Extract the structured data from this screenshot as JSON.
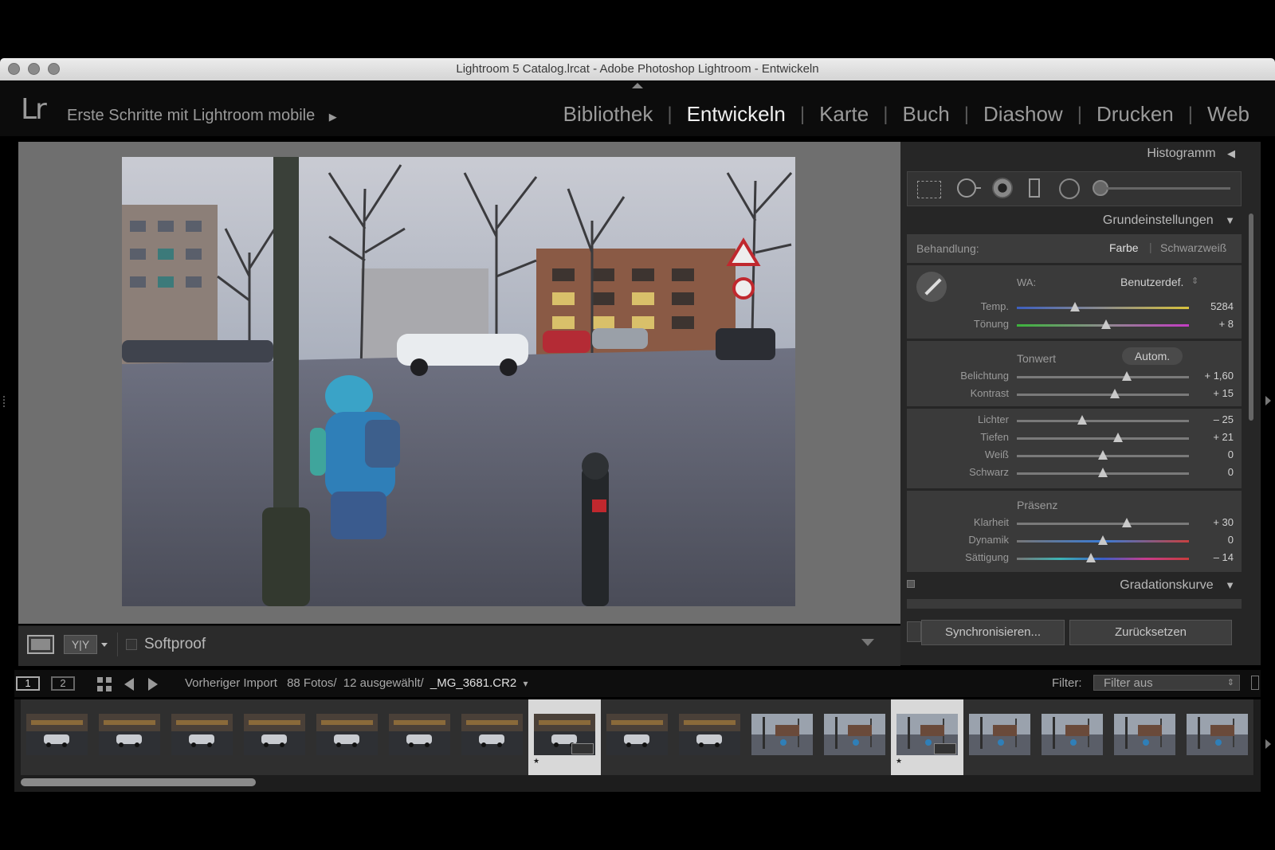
{
  "window": {
    "title": "Lightroom 5 Catalog.lrcat - Adobe Photoshop Lightroom - Entwickeln"
  },
  "topbar": {
    "logo": "Lr",
    "identity": "Erste Schritte mit Lightroom mobile",
    "identity_arrow": "▶",
    "modules": [
      {
        "label": "Bibliothek"
      },
      {
        "label": "Entwickeln"
      },
      {
        "label": "Karte"
      },
      {
        "label": "Buch"
      },
      {
        "label": "Diashow"
      },
      {
        "label": "Drucken"
      },
      {
        "label": "Web"
      }
    ],
    "active_module": "Entwickeln"
  },
  "right_panel": {
    "histogram_label": "Histogramm",
    "histogram_arrow": "◀",
    "basic_label": "Grundeinstellungen",
    "basic_arrow": "▼",
    "treatment_label": "Behandlung:",
    "treatment_color": "Farbe",
    "treatment_bw": "Schwarzweiß",
    "wb_label": "WA:",
    "wb_value": "Benutzerdef.",
    "wb_arrow": "⇕",
    "tone_label": "Tonwert",
    "auto_label": "Autom.",
    "presence_label": "Präsenz",
    "sliders_wb": [
      {
        "label": "Temp.",
        "value": "5284",
        "level": 0.34
      },
      {
        "label": "Tönung",
        "value": "+ 8",
        "level": 0.52
      }
    ],
    "sliders_tone1": [
      {
        "label": "Belichtung",
        "value": "+ 1,60",
        "level": 0.64
      },
      {
        "label": "Kontrast",
        "value": "+ 15",
        "level": 0.57
      }
    ],
    "sliders_tone2": [
      {
        "label": "Lichter",
        "value": "– 25",
        "level": 0.38
      },
      {
        "label": "Tiefen",
        "value": "+ 21",
        "level": 0.59
      },
      {
        "label": "Weiß",
        "value": "0",
        "level": 0.5
      },
      {
        "label": "Schwarz",
        "value": "0",
        "level": 0.5
      }
    ],
    "sliders_presence": [
      {
        "label": "Klarheit",
        "value": "+ 30",
        "level": 0.64
      },
      {
        "label": "Dynamik",
        "value": "0",
        "level": 0.5
      },
      {
        "label": "Sättigung",
        "value": "– 14",
        "level": 0.43
      }
    ],
    "curve_label": "Gradationskurve",
    "curve_arrow": "▼",
    "sync_button": "Synchronisieren...",
    "reset_button": "Zurücksetzen"
  },
  "toolbar": {
    "softproof_label": "Softproof",
    "yy_label": "Y|Y"
  },
  "filmstrip_header": {
    "screen1": "1",
    "screen2": "2",
    "source": "Vorheriger Import",
    "count": "88 Fotos/",
    "selected": "12 ausgewählt/",
    "filename": "_MG_3681.CR2",
    "filename_arrow": "▾",
    "filter_label": "Filter:",
    "filter_value": "Filter aus",
    "filter_arrow": "⇕"
  },
  "filmstrip": {
    "thumbnails": [
      {
        "kind": "street",
        "selected": false,
        "star": ""
      },
      {
        "kind": "street",
        "selected": false,
        "star": ""
      },
      {
        "kind": "street",
        "selected": false,
        "star": ""
      },
      {
        "kind": "street",
        "selected": false,
        "star": ""
      },
      {
        "kind": "street",
        "selected": false,
        "star": ""
      },
      {
        "kind": "street",
        "selected": false,
        "star": ""
      },
      {
        "kind": "street",
        "selected": false,
        "star": ""
      },
      {
        "kind": "street",
        "selected": true,
        "star": "★"
      },
      {
        "kind": "street",
        "selected": false,
        "star": ""
      },
      {
        "kind": "street",
        "selected": false,
        "star": ""
      },
      {
        "kind": "square",
        "selected": false,
        "star": ""
      },
      {
        "kind": "square",
        "selected": false,
        "star": ""
      },
      {
        "kind": "square",
        "selected": true,
        "star": "★"
      },
      {
        "kind": "square",
        "selected": false,
        "star": ""
      },
      {
        "kind": "square",
        "selected": false,
        "star": ""
      },
      {
        "kind": "square",
        "selected": false,
        "star": ""
      },
      {
        "kind": "square",
        "selected": false,
        "star": ""
      }
    ]
  }
}
